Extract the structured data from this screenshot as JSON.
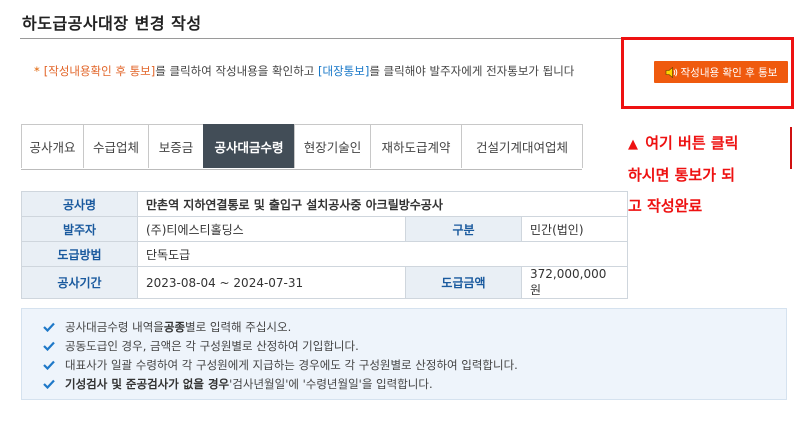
{
  "page": {
    "title": "하도급공사대장 변경 작성"
  },
  "notice": {
    "star": "*",
    "part1": "[작성내용확인 후 통보]",
    "part2": "를 클릭하여 작성내용을 확인하고 ",
    "part3": "[대장통보]",
    "part4": "를 클릭해야 발주자에게 전자통보가 됩니다",
    "button_label": "작성내용 확인 후 통보"
  },
  "annotation": {
    "arrow": "▲",
    "line1": "여기 버튼 클릭",
    "line2": "하시면 통보가 되",
    "line3": "고 작성완료"
  },
  "tabs": [
    {
      "label": "공사개요"
    },
    {
      "label": "수급업체"
    },
    {
      "label": "보증금"
    },
    {
      "label": "공사대금수령",
      "active": true
    },
    {
      "label": "현장기술인"
    },
    {
      "label": "재하도급계약"
    },
    {
      "label": "건설기계대여업체"
    }
  ],
  "project": {
    "name_label": "공사명",
    "name_value": "만촌역 지하연결통로 및 출입구 설치공사중 아크릴방수공사",
    "client_label": "발주자",
    "client_value": "(주)티에스티홀딩스",
    "type_label": "구분",
    "type_value": "민간(법인)",
    "method_label": "도급방법",
    "method_value": "단독도급",
    "period_label": "공사기간",
    "period_value": "2023-08-04 ~ 2024-07-31",
    "amount_label": "도급금액",
    "amount_value": "372,000,000 원"
  },
  "info": {
    "line1_a": "공사대금수령 내역을 ",
    "line1_b": "공종",
    "line1_c": "별로 입력해 주십시오.",
    "line2": "공동도급인 경우, 금액은 각 구성원별로 산정하여 기입합니다.",
    "line3": "대표사가 일괄 수령하여 각 구성원에게 지급하는 경우에도 각 구성원별로 산정하여 입력합니다.",
    "line4_a": "기성검사 및 준공검사가 없을 경우",
    "line4_b": " '검사년월일'에 '수령년월일'을 입력합니다."
  },
  "colors": {
    "button": "#ef5a0e",
    "active_tab": "#424d57",
    "highlight_frame": "#ee1111",
    "label_text": "#1a5a9e",
    "check": "#1e78c8"
  }
}
